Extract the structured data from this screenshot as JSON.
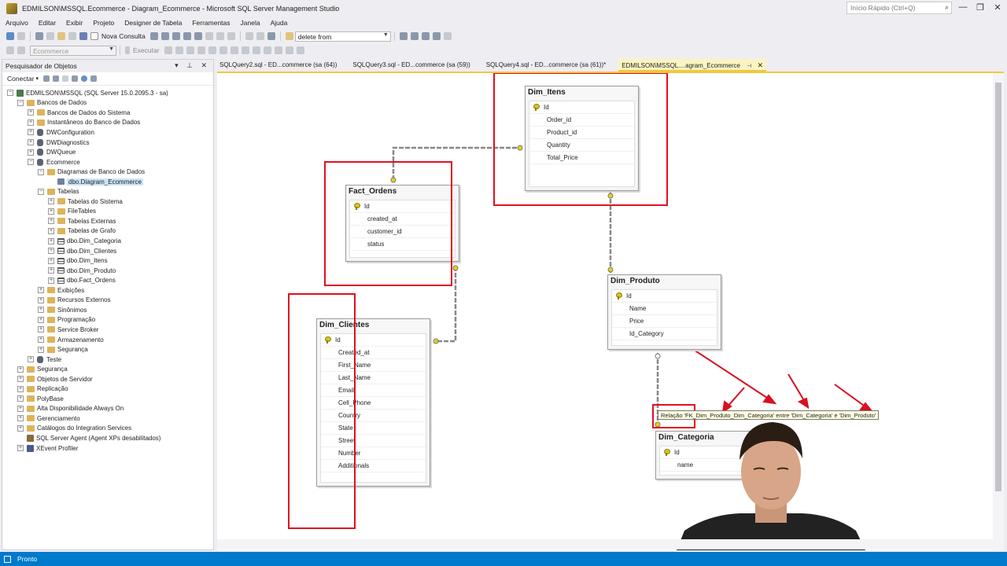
{
  "window": {
    "title": "EDMILSON\\MSSQL.Ecommerce - Diagram_Ecommerce - Microsoft SQL Server Management Studio",
    "quick_launch_placeholder": "Início Rápido (Ctrl+Q)"
  },
  "menu": [
    "Arquivo",
    "Editar",
    "Exibir",
    "Projeto",
    "Designer de Tabela",
    "Ferramentas",
    "Janela",
    "Ajuda"
  ],
  "toolbar": {
    "new_query_label": "Nova Consulta",
    "search_combo_value": "delete from",
    "database_combo_value": "Ecommerce",
    "execute_label": "Executar"
  },
  "object_explorer": {
    "title": "Pesquisador de Objetos",
    "connect_label": "Conectar",
    "tree": [
      {
        "label": "EDMILSON\\MSSQL (SQL Server 15.0.2095.3 - sa)",
        "level": 0,
        "icon": "server",
        "exp": "−"
      },
      {
        "label": "Bancos de Dados",
        "level": 1,
        "icon": "folder",
        "exp": "−"
      },
      {
        "label": "Bancos de Dados do Sistema",
        "level": 2,
        "icon": "folder",
        "exp": "+"
      },
      {
        "label": "Instantâneos do Banco de Dados",
        "level": 2,
        "icon": "folder",
        "exp": "+"
      },
      {
        "label": "DWConfiguration",
        "level": 2,
        "icon": "db",
        "exp": "+"
      },
      {
        "label": "DWDiagnostics",
        "level": 2,
        "icon": "db",
        "exp": "+"
      },
      {
        "label": "DWQueue",
        "level": 2,
        "icon": "db",
        "exp": "+"
      },
      {
        "label": "Ecommerce",
        "level": 2,
        "icon": "db",
        "exp": "−"
      },
      {
        "label": "Diagramas de Banco de Dados",
        "level": 3,
        "icon": "folder",
        "exp": "−"
      },
      {
        "label": "dbo.Diagram_Ecommerce",
        "level": 4,
        "icon": "diagram",
        "exp": "",
        "selected": true
      },
      {
        "label": "Tabelas",
        "level": 3,
        "icon": "folder",
        "exp": "−"
      },
      {
        "label": "Tabelas do Sistema",
        "level": 4,
        "icon": "folder",
        "exp": "+"
      },
      {
        "label": "FileTables",
        "level": 4,
        "icon": "folder",
        "exp": "+"
      },
      {
        "label": "Tabelas Externas",
        "level": 4,
        "icon": "folder",
        "exp": "+"
      },
      {
        "label": "Tabelas de Grafo",
        "level": 4,
        "icon": "folder",
        "exp": "+"
      },
      {
        "label": "dbo.Dim_Categoria",
        "level": 4,
        "icon": "table",
        "exp": "+"
      },
      {
        "label": "dbo.Dim_Clientes",
        "level": 4,
        "icon": "table",
        "exp": "+"
      },
      {
        "label": "dbo.Dim_Itens",
        "level": 4,
        "icon": "table",
        "exp": "+"
      },
      {
        "label": "dbo.Dim_Produto",
        "level": 4,
        "icon": "table",
        "exp": "+"
      },
      {
        "label": "dbo.Fact_Ordens",
        "level": 4,
        "icon": "table",
        "exp": "+"
      },
      {
        "label": "Exibições",
        "level": 3,
        "icon": "folder",
        "exp": "+"
      },
      {
        "label": "Recursos Externos",
        "level": 3,
        "icon": "folder",
        "exp": "+"
      },
      {
        "label": "Sinônimos",
        "level": 3,
        "icon": "folder",
        "exp": "+"
      },
      {
        "label": "Programação",
        "level": 3,
        "icon": "folder",
        "exp": "+"
      },
      {
        "label": "Service Broker",
        "level": 3,
        "icon": "folder",
        "exp": "+"
      },
      {
        "label": "Armazenamento",
        "level": 3,
        "icon": "folder",
        "exp": "+"
      },
      {
        "label": "Segurança",
        "level": 3,
        "icon": "folder",
        "exp": "+"
      },
      {
        "label": "Teste",
        "level": 2,
        "icon": "db",
        "exp": "+"
      },
      {
        "label": "Segurança",
        "level": 1,
        "icon": "folder",
        "exp": "+"
      },
      {
        "label": "Objetos de Servidor",
        "level": 1,
        "icon": "folder",
        "exp": "+"
      },
      {
        "label": "Replicação",
        "level": 1,
        "icon": "folder",
        "exp": "+"
      },
      {
        "label": "PolyBase",
        "level": 1,
        "icon": "folder",
        "exp": "+"
      },
      {
        "label": "Alta Disponibilidade Always On",
        "level": 1,
        "icon": "folder",
        "exp": "+"
      },
      {
        "label": "Gerenciamento",
        "level": 1,
        "icon": "folder",
        "exp": "+"
      },
      {
        "label": "Catálogos do Integration Services",
        "level": 1,
        "icon": "folder",
        "exp": "+"
      },
      {
        "label": "SQL Server Agent (Agent XPs desabilitados)",
        "level": 1,
        "icon": "agent",
        "exp": ""
      },
      {
        "label": "XEvent Profiler",
        "level": 1,
        "icon": "xe",
        "exp": "+"
      }
    ]
  },
  "tabs": [
    {
      "label": "SQLQuery2.sql - ED...commerce (sa (64))",
      "active": false
    },
    {
      "label": "SQLQuery3.sql - ED...commerce (sa (59))",
      "active": false
    },
    {
      "label": "SQLQuery4.sql - ED...commerce (sa (61))*",
      "active": false
    },
    {
      "label": "EDMILSON\\MSSQL....agram_Ecommerce",
      "active": true
    }
  ],
  "diagram": {
    "tables": {
      "dim_itens": {
        "name": "Dim_Itens",
        "columns": [
          "Id",
          "Order_id",
          "Product_id",
          "Quantity",
          "Total_Price"
        ]
      },
      "fact_ordens": {
        "name": "Fact_Ordens",
        "columns": [
          "Id",
          "created_at",
          "customer_id",
          "status"
        ]
      },
      "dim_produto": {
        "name": "Dim_Produto",
        "columns": [
          "Id",
          "Name",
          "Price",
          "Id_Category"
        ]
      },
      "dim_clientes": {
        "name": "Dim_Clientes",
        "columns": [
          "Id",
          "Created_at",
          "First_Name",
          "Last_Name",
          "Email",
          "Cell_Phone",
          "Country",
          "State",
          "Street",
          "Number",
          "Additionals"
        ]
      },
      "dim_categoria": {
        "name": "Dim_Categoria",
        "columns": [
          "Id",
          "name"
        ]
      }
    },
    "relationship_tooltip": "Relação 'FK_Dim_Produto_Dim_Categoria' entre 'Dim_Categoria' e 'Dim_Produto'"
  },
  "status": {
    "text": "Pronto"
  },
  "colors": {
    "accent": "#007acc",
    "highlight_red": "#e0101e",
    "tab_active": "#fbf4c2"
  }
}
